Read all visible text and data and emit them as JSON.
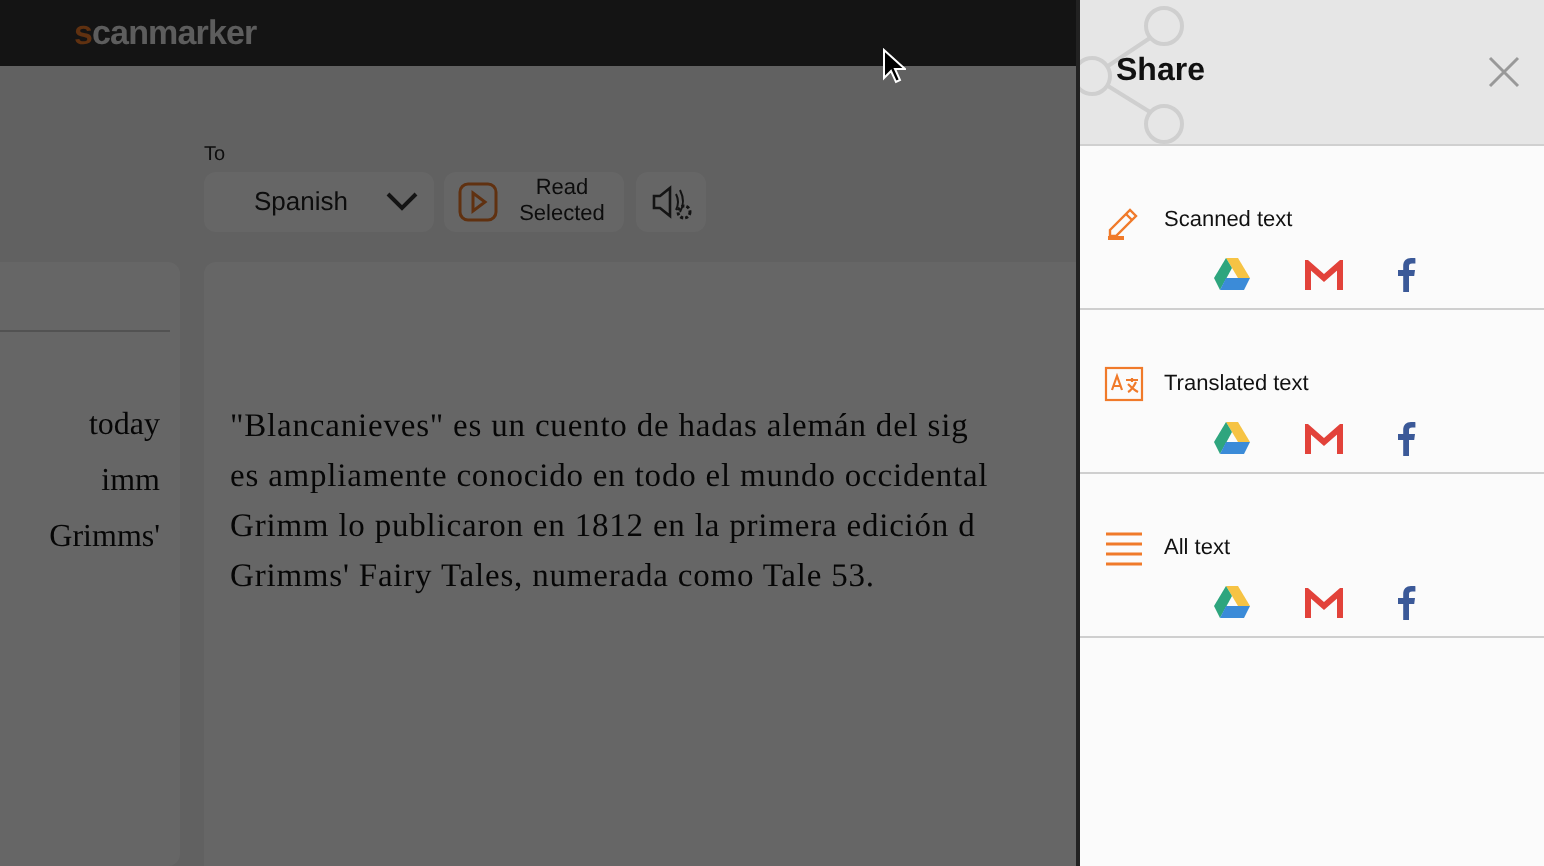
{
  "app": {
    "logo": "scanmarker"
  },
  "toolbar": {
    "target_label": "To",
    "target_language": "Spanish",
    "read_button": "Read Selected"
  },
  "source_panel": {
    "lines": [
      "today",
      "imm",
      "Grimms'"
    ]
  },
  "translation_panel": {
    "lines": [
      "\"Blancanieves\" es un cuento de hadas alemán del sig",
      "es ampliamente conocido en todo el mundo occidental",
      "Grimm lo publicaron en 1812 en la primera edición d",
      "Grimms' Fairy Tales, numerada como Tale 53."
    ]
  },
  "share_panel": {
    "title": "Share",
    "sections": [
      {
        "kind": "pen",
        "label": "Scanned text",
        "targets": [
          {
            "kind": "drive"
          },
          {
            "kind": "gmail"
          },
          {
            "kind": "facebook"
          }
        ]
      },
      {
        "kind": "translate",
        "label": "Translated text",
        "targets": [
          {
            "kind": "drive"
          },
          {
            "kind": "gmail"
          },
          {
            "kind": "facebook"
          }
        ]
      },
      {
        "kind": "lines",
        "label": "All text",
        "targets": [
          {
            "kind": "drive"
          },
          {
            "kind": "gmail"
          },
          {
            "kind": "facebook"
          }
        ]
      }
    ]
  }
}
